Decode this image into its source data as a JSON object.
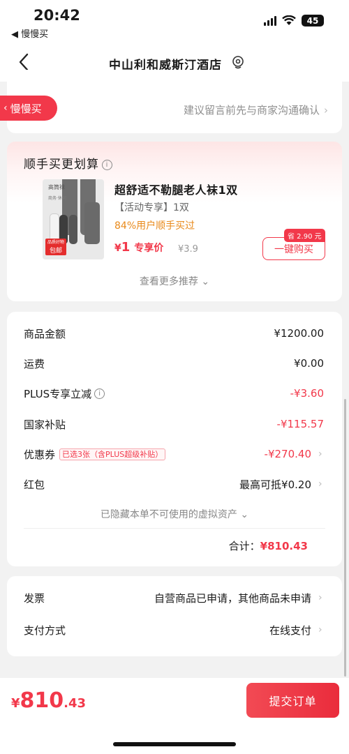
{
  "status": {
    "time": "20:42",
    "back_app": "◀ 慢慢买",
    "battery": "45"
  },
  "nav": {
    "title": "中山利和威斯汀酒店"
  },
  "pill": {
    "label": "慢慢买"
  },
  "notice": {
    "text": "建议留言前先与商家沟通确认"
  },
  "recommend": {
    "title": "顺手买更划算",
    "product": {
      "image_tag_top": "高筒袜",
      "image_tag_sub": "商务·休闲",
      "image_badge_line1": "品质好物",
      "image_badge_line2": "包邮",
      "name": "超舒适不勒腿老人袜1双",
      "spec": "【活动专享】1双",
      "bought": "84%用户顺手买过",
      "price_symbol": "¥",
      "price": "1",
      "price_tag": "专享价",
      "original_price": "¥3.9",
      "save_tag": "省 2.90 元",
      "buy_label": "一键购买"
    },
    "more_label": "查看更多推荐 ⌄"
  },
  "summary": {
    "rows": [
      {
        "label": "商品金额",
        "value": "¥1200.00"
      },
      {
        "label": "运费",
        "value": "¥0.00"
      },
      {
        "label": "PLUS专享立减",
        "value": "-¥3.60"
      },
      {
        "label": "国家补贴",
        "value": "-¥115.57"
      },
      {
        "label": "优惠券",
        "tag": "已选3张（含PLUS超级补贴）",
        "value": "-¥270.40"
      },
      {
        "label": "红包",
        "value": "最高可抵¥0.20"
      }
    ],
    "hidden_note": "已隐藏本单不可使用的虚拟资产 ⌄",
    "total_label": "合计：",
    "total_value": "¥810.43"
  },
  "invoice": {
    "label": "发票",
    "value": "自营商品已申请，其他商品未申请"
  },
  "payment": {
    "label": "支付方式",
    "value": "在线支付"
  },
  "footer": {
    "amount_symbol": "¥",
    "amount_int": "810",
    "amount_dec": ".43",
    "submit_label": "提交订单"
  },
  "colors": {
    "accent": "#f2384a",
    "orange": "#e98a1b"
  }
}
